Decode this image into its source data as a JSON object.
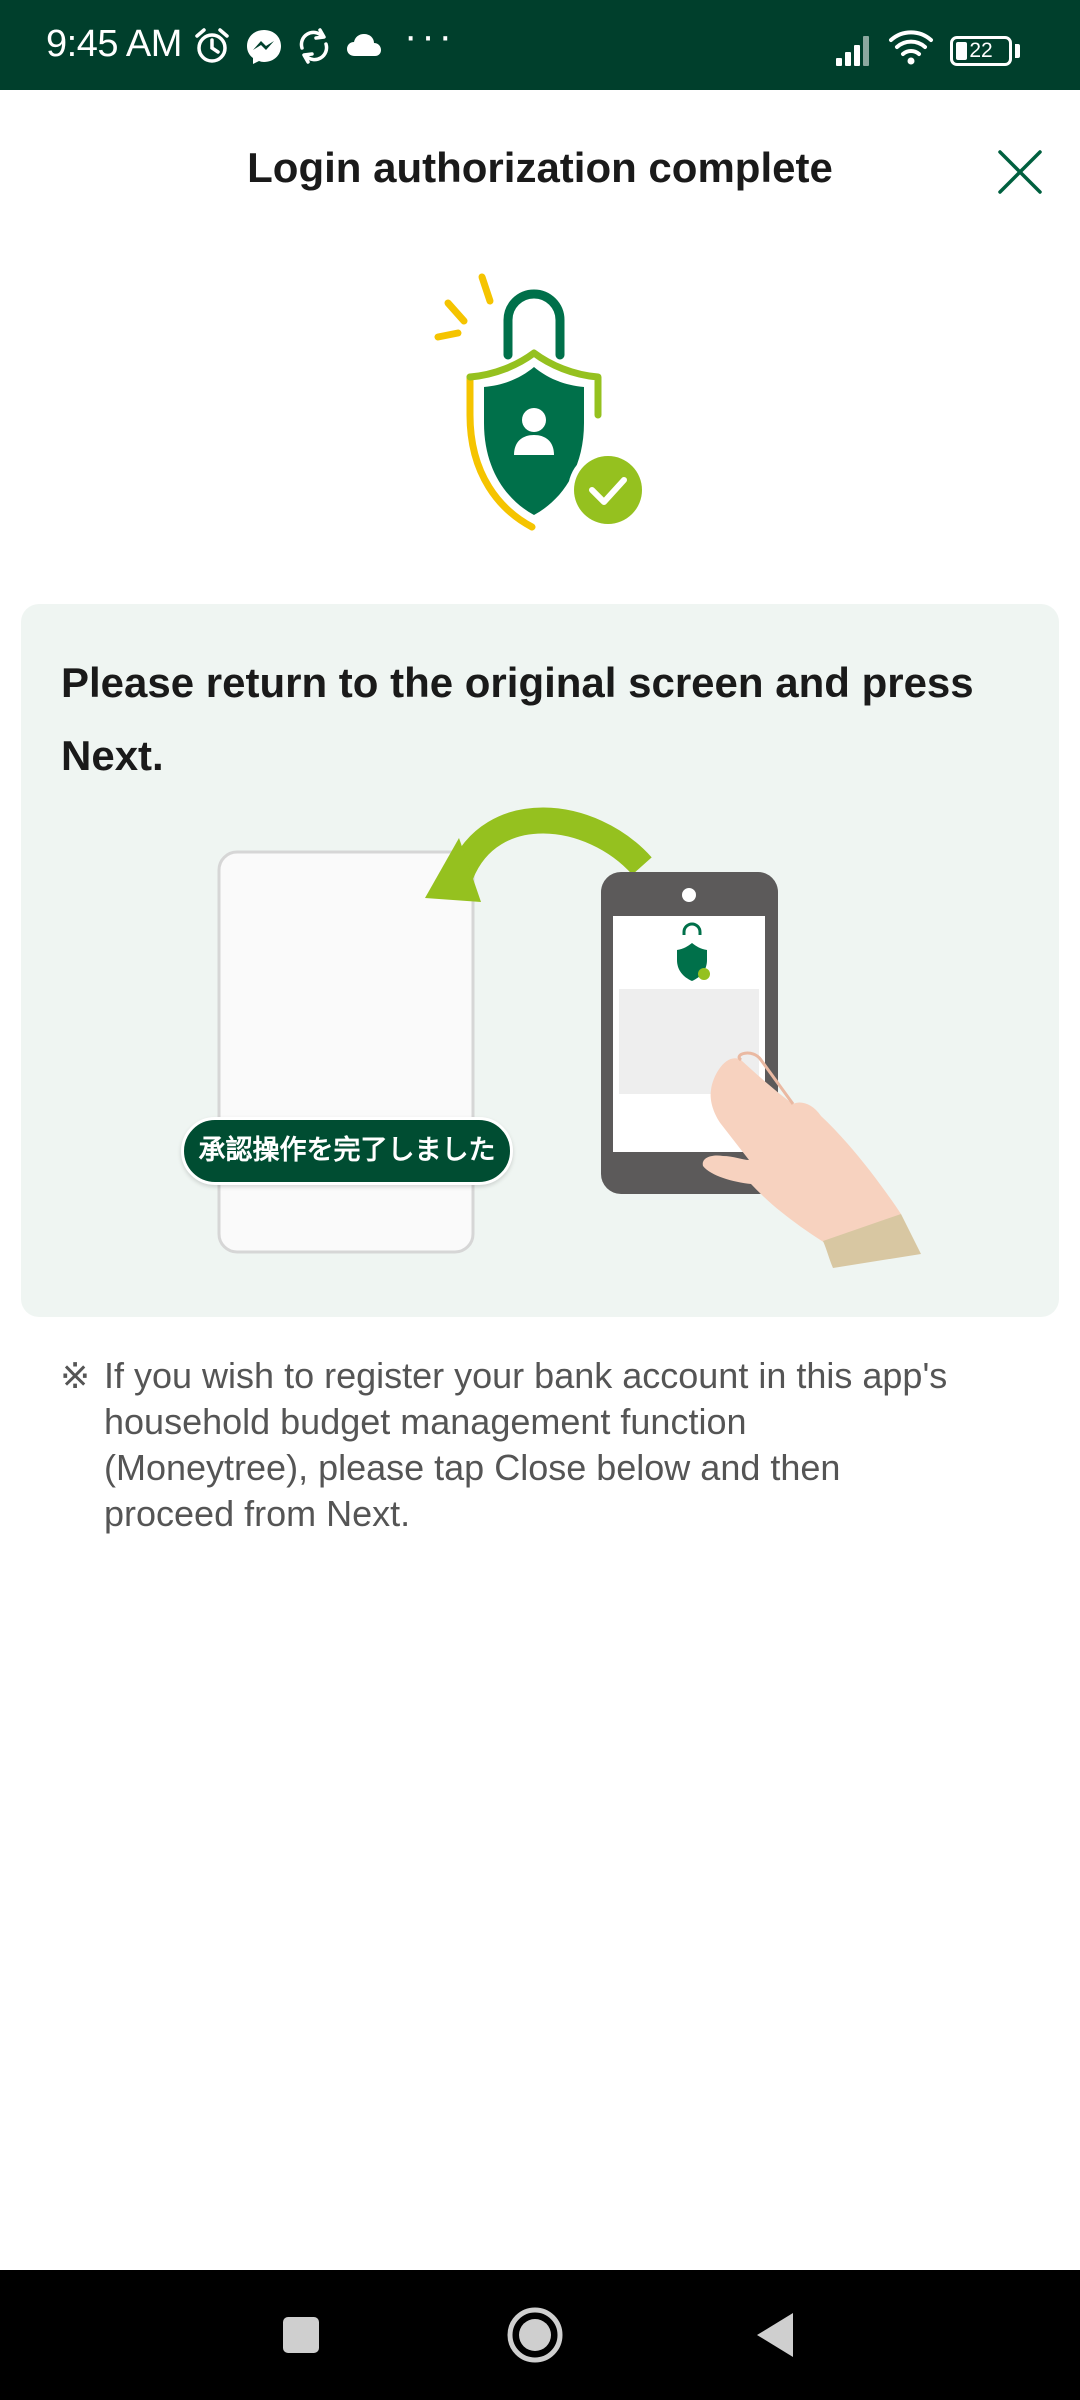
{
  "status_bar": {
    "time": "9:45 AM",
    "battery_level": "22",
    "battery_fraction": 0.22,
    "overflow": "···",
    "icons": [
      "alarm-icon",
      "messenger-icon",
      "sync-icon",
      "cloud-icon",
      "signal-icon",
      "wifi-icon",
      "battery-icon"
    ]
  },
  "header": {
    "title": "Login authorization complete",
    "close_icon": "close-icon"
  },
  "hero": {
    "icon": "shield-lock-check-icon"
  },
  "card": {
    "heading": "Please return to the original screen and press Next.",
    "illustration_badge": "承認操作を完了しました"
  },
  "note": {
    "mark": "※",
    "text": "If you wish to register your bank account in this app's household budget management function (Moneytree), please tap Close below and then proceed from Next."
  },
  "nav_bar": {
    "buttons": [
      "recents-square-icon",
      "home-circle-icon",
      "back-triangle-icon"
    ]
  },
  "colors": {
    "status_bar_bg": "#003f2c",
    "brand_green": "#00704a",
    "accent_lime": "#95c11f",
    "accent_yellow": "#f5c400",
    "card_bg": "#eff5f2",
    "badge_bg": "#004d32"
  }
}
